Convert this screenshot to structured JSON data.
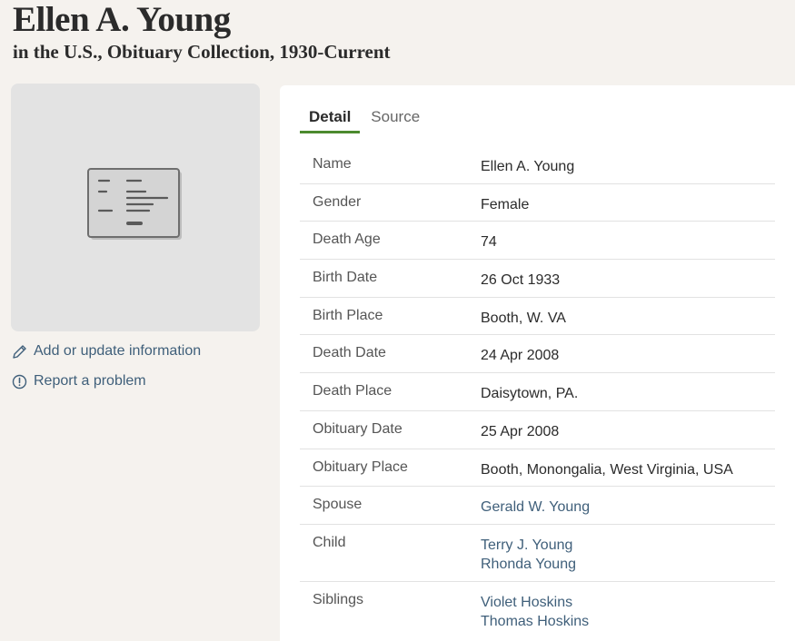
{
  "header": {
    "name": "Ellen A. Young",
    "collection": "in the U.S., Obituary Collection, 1930-Current"
  },
  "thumbnail": {
    "icon": "record-card-icon"
  },
  "actions": {
    "add_update": "Add or update information",
    "report": "Report a problem"
  },
  "tabs": [
    {
      "label": "Detail",
      "active": true
    },
    {
      "label": "Source",
      "active": false
    }
  ],
  "details": {
    "name": {
      "label": "Name",
      "value": "Ellen A. Young"
    },
    "gender": {
      "label": "Gender",
      "value": "Female"
    },
    "death_age": {
      "label": "Death Age",
      "value": "74"
    },
    "birth_date": {
      "label": "Birth Date",
      "value": "26 Oct 1933"
    },
    "birth_place": {
      "label": "Birth Place",
      "value": "Booth, W. VA"
    },
    "death_date": {
      "label": "Death Date",
      "value": "24 Apr 2008"
    },
    "death_place": {
      "label": "Death Place",
      "value": "Daisytown, PA."
    },
    "obituary_date": {
      "label": "Obituary Date",
      "value": "25 Apr 2008"
    },
    "obituary_place": {
      "label": "Obituary Place",
      "value": "Booth, Monongalia, West Virginia, USA"
    },
    "spouse": {
      "label": "Spouse",
      "values": [
        "Gerald W. Young"
      ]
    },
    "child": {
      "label": "Child",
      "values": [
        "Terry J. Young",
        "Rhonda Young"
      ]
    },
    "siblings": {
      "label": "Siblings",
      "values": [
        "Violet Hoskins",
        "Thomas Hoskins"
      ]
    }
  },
  "colors": {
    "link": "#3f5f7a",
    "tab_accent": "#4c8a2e",
    "page_bg": "#f5f2ee"
  }
}
